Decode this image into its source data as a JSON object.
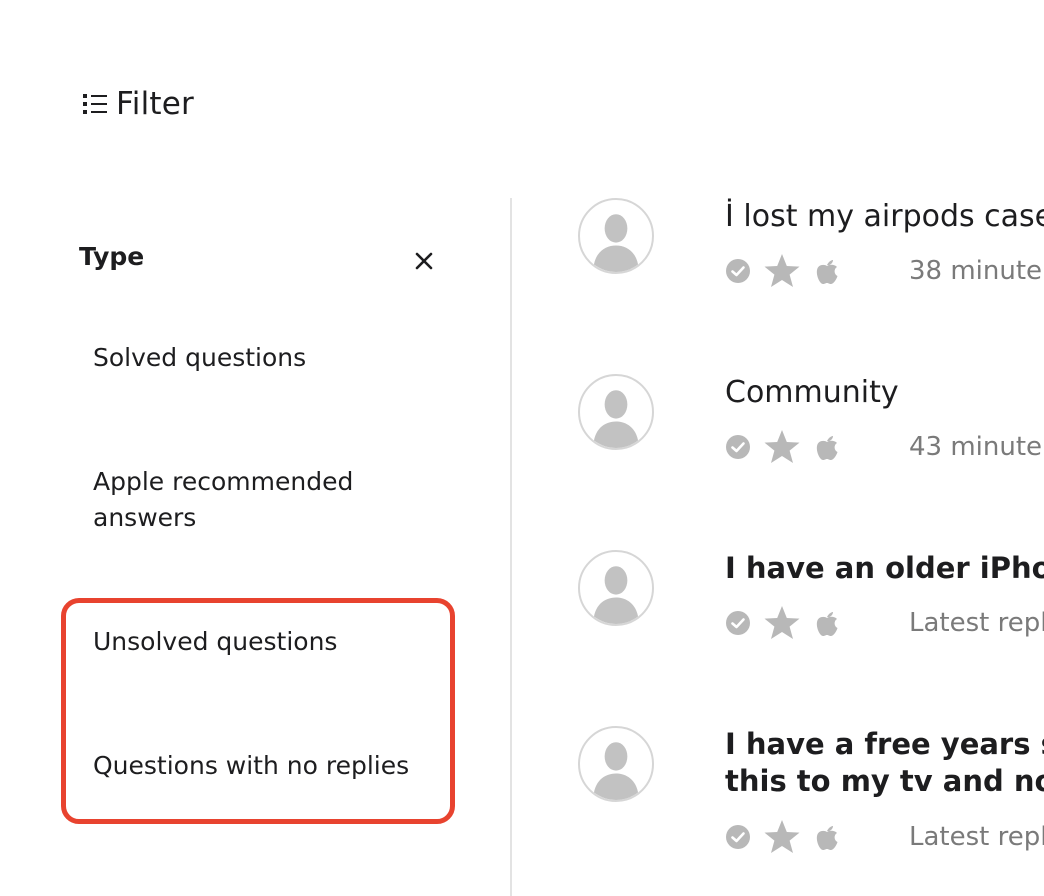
{
  "filter": {
    "label": "Filter"
  },
  "type_section": {
    "heading": "Type",
    "options": [
      "Solved questions",
      "Apple recommended answers",
      "Unsolved questions",
      "Questions with no replies"
    ]
  },
  "threads": [
    {
      "title": "İ lost my airpods case",
      "title_line2": "",
      "meta": "38 minute",
      "unread": false
    },
    {
      "title": "Community",
      "title_line2": "",
      "meta": "43 minute",
      "unread": false
    },
    {
      "title": "I have an older iPhon",
      "title_line2": "",
      "meta": "Latest repl",
      "unread": true
    },
    {
      "title": "I have a free years su",
      "title_line2": "this to my tv and now",
      "meta": "Latest repl",
      "unread": true
    }
  ],
  "colors": {
    "highlight": "#e8432f",
    "badge_gray": "#b8b8b8",
    "meta_text": "#7a7a7a",
    "divider": "#e3e3e3"
  },
  "icons": {
    "filter": "list-filter-icon",
    "close": "close-icon",
    "avatar": "user-silhouette-icon",
    "check": "check-circle-icon",
    "star": "star-icon",
    "apple": "apple-logo-icon"
  }
}
